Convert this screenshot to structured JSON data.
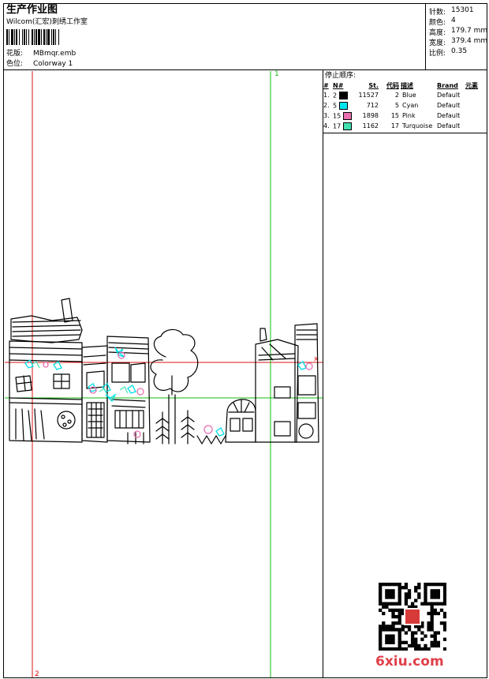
{
  "header": {
    "title": "生产作业图",
    "company": "Wilcom(汇宏)刺绣工作室",
    "design_label": "花版:",
    "design_value": "MBmqr.emb",
    "colorway_label": "色位:",
    "colorway_value": "Colorway 1"
  },
  "stats": [
    {
      "label": "针数:",
      "value": "15301"
    },
    {
      "label": "颜色:",
      "value": "4"
    },
    {
      "label": "高度:",
      "value": "179.7 mm"
    },
    {
      "label": "宽度:",
      "value": "379.4 mm"
    },
    {
      "label": "比例:",
      "value": "0.35"
    }
  ],
  "stop_sequence": {
    "title": "停止顺序:",
    "headers": [
      "#",
      "N#",
      "St.",
      "代码",
      "描述",
      "Brand",
      "元素"
    ],
    "rows": [
      {
        "idx": "1.",
        "n": "2",
        "stitches": "11527",
        "code": "2",
        "desc": "Blue",
        "brand": "Default",
        "swatch": "#000000"
      },
      {
        "idx": "2.",
        "n": "5",
        "stitches": "712",
        "code": "5",
        "desc": "Cyan",
        "brand": "Default",
        "swatch": "#00e5ee"
      },
      {
        "idx": "3.",
        "n": "15",
        "stitches": "1898",
        "code": "15",
        "desc": "Pink",
        "brand": "Default",
        "swatch": "#e870b0"
      },
      {
        "idx": "4.",
        "n": "17",
        "stitches": "1162",
        "code": "17",
        "desc": "Turquoise",
        "brand": "Default",
        "swatch": "#40e0b0"
      }
    ]
  },
  "guides": {
    "label_green": "1",
    "label_red": "2",
    "marker_x": "x"
  },
  "watermark": "6xiu.com",
  "colors": {
    "guide_red": "#dd1111",
    "guide_green": "#11bb11"
  }
}
